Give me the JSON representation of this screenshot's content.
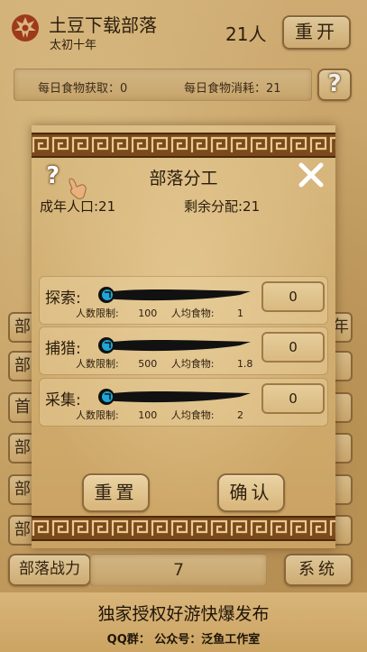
{
  "header": {
    "tribe_name": "土豆下载部落",
    "era": "太初十年",
    "population": "21人",
    "restart_label": "重开"
  },
  "food": {
    "daily_gain": "每日食物获取：0",
    "daily_consume": "每日食物消耗：21",
    "help": "?"
  },
  "background_buttons": {
    "left": [
      "部",
      "部",
      "首",
      "部",
      "部",
      "部"
    ],
    "right": [
      "年",
      "",
      "",
      "",
      "",
      ""
    ]
  },
  "bottom": {
    "power_label": "部落战力",
    "power_value": "7",
    "system_label": "系统"
  },
  "footer": {
    "line1": "独家授权好游快爆发布",
    "line2": "QQ群：  公众号：泛鱼工作室"
  },
  "modal": {
    "title": "部落分工",
    "help": "?",
    "adult_population": "成年人口:21",
    "remaining": "剩余分配:21",
    "jobs": [
      {
        "name": "探索:",
        "limit_label": "人数限制:",
        "limit": "100",
        "food_label": "人均食物:",
        "food": "1",
        "value": "0",
        "slider_fraction": 0
      },
      {
        "name": "捕猎:",
        "limit_label": "人数限制:",
        "limit": "500",
        "food_label": "人均食物:",
        "food": "1.8",
        "value": "0",
        "slider_fraction": 0
      },
      {
        "name": "采集:",
        "limit_label": "人数限制:",
        "limit": "100",
        "food_label": "人均食物:",
        "food": "2",
        "value": "0",
        "slider_fraction": 0
      }
    ],
    "reset_label": "重置",
    "confirm_label": "确认"
  },
  "colors": {
    "emblem": "#a33a1c",
    "ink": "#111111",
    "slider_knob": "#1ea6d6",
    "border": "#8e6a3c"
  },
  "icons": [
    "horde-emblem-icon",
    "help-icon",
    "pointing-hand-icon",
    "close-icon"
  ]
}
